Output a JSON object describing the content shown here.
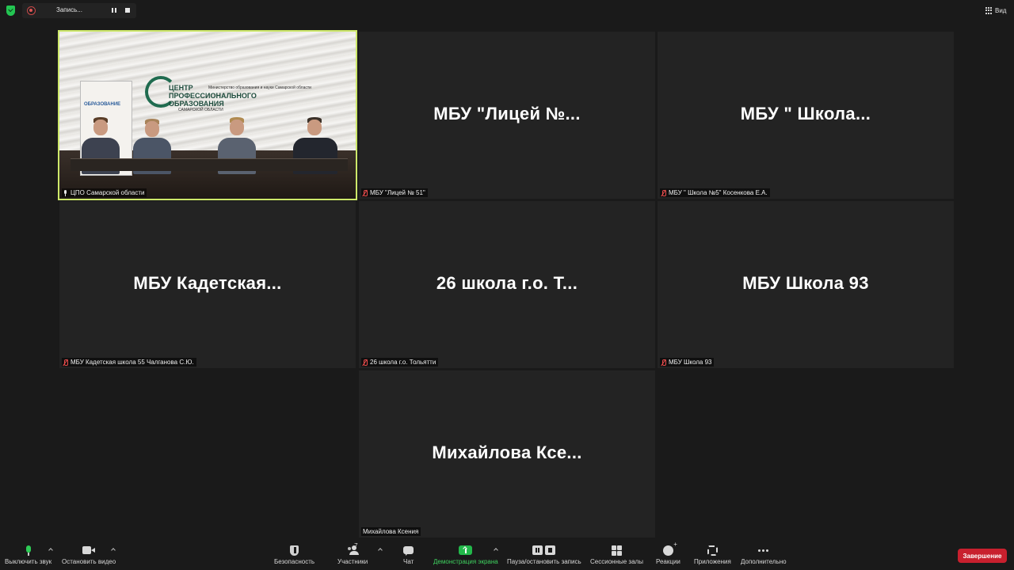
{
  "topbar": {
    "recording_label": "Запись...",
    "view_label": "Вид"
  },
  "tiles": [
    {
      "display_name": "",
      "label": "ЦПО Самарской области",
      "muted": false,
      "has_video": true
    },
    {
      "display_name": "МБУ  \"Лицей №...",
      "label": "МБУ \"Лицей № 51\"",
      "muted": true
    },
    {
      "display_name": "МБУ  \"  Школа...",
      "label": "МБУ \" Школа №5\" Косенкова Е.А.",
      "muted": true
    },
    {
      "display_name": "МБУ  Кадетская...",
      "label": "МБУ Кадетская школа 55 Чалганова С.Ю.",
      "muted": true
    },
    {
      "display_name": "26  школа г.о.  Т...",
      "label": "26 школа г.о. Тольятти",
      "muted": true
    },
    {
      "display_name": "МБУ Школа 93",
      "label": "МБУ Школа 93",
      "muted": true
    },
    {
      "display_name": "Михайлова  Ксе...",
      "label": "Михайлова Ксения",
      "muted": false
    }
  ],
  "video_content": {
    "banner_text": "ОБРАЗОВАНИЕ",
    "logo_text": "ЦЕНТР ПРОФЕССИОНАЛЬНОГО ОБРАЗОВАНИЯ",
    "logo_sub": "САМАРСКОЙ ОБЛАСТИ",
    "ministry_text": "Министерство образования и науки Самарской области"
  },
  "toolbar": {
    "mute_label": "Выключить звук",
    "video_label": "Остановить видео",
    "security_label": "Безопасность",
    "participants_label": "Участники",
    "participants_count": "7",
    "chat_label": "Чат",
    "share_label": "Демонстрация экрана",
    "pause_rec_label": "Пауза/остановить запись",
    "rooms_label": "Сессионные залы",
    "reactions_label": "Реакции",
    "apps_label": "Приложения",
    "more_label": "Дополнительно",
    "end_label": "Завершение"
  },
  "colors": {
    "background": "#1a1a1a",
    "tile": "#232323",
    "active_speaker_border": "#cde86a",
    "share_green": "#22b84a",
    "end_red": "#c8202e",
    "muted_red": "#e64b4b"
  }
}
